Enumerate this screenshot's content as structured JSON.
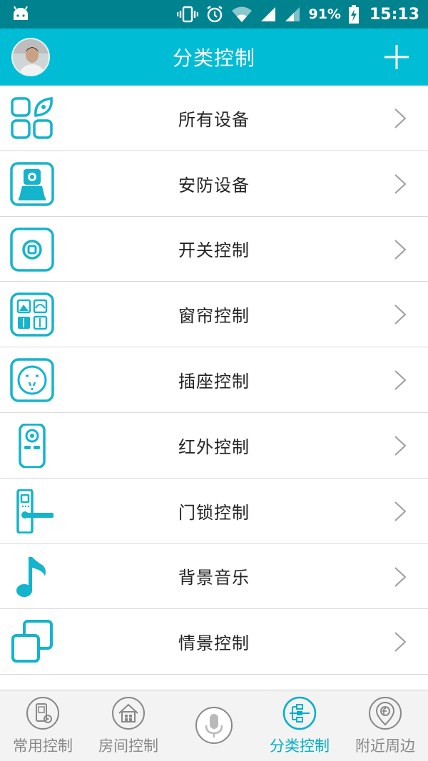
{
  "status_bar": {
    "battery_percent": "91%",
    "time": "15:13",
    "icons": [
      "android-icon",
      "vibrate-icon",
      "alarm-icon",
      "wifi-icon",
      "signal-icon",
      "signal-icon",
      "battery-charging-icon"
    ]
  },
  "header": {
    "title": "分类控制",
    "add_icon": "plus-icon",
    "avatar": "user-avatar"
  },
  "categories": [
    {
      "label": "所有设备",
      "icon": "all-devices-icon"
    },
    {
      "label": "安防设备",
      "icon": "security-camera-icon"
    },
    {
      "label": "开关控制",
      "icon": "switch-icon"
    },
    {
      "label": "窗帘控制",
      "icon": "curtain-icon"
    },
    {
      "label": "插座控制",
      "icon": "socket-icon"
    },
    {
      "label": "红外控制",
      "icon": "remote-control-icon"
    },
    {
      "label": "门锁控制",
      "icon": "door-lock-icon"
    },
    {
      "label": "背景音乐",
      "icon": "music-note-icon"
    },
    {
      "label": "情景控制",
      "icon": "scene-icon"
    }
  ],
  "bottom_nav": {
    "items": [
      {
        "label": "常用控制",
        "icon": "common-control-icon",
        "active": false
      },
      {
        "label": "房间控制",
        "icon": "room-control-icon",
        "active": false
      },
      {
        "label": "",
        "icon": "microphone-icon",
        "active": false
      },
      {
        "label": "分类控制",
        "icon": "category-control-icon",
        "active": true
      },
      {
        "label": "附近周边",
        "icon": "nearby-icon",
        "active": false
      }
    ]
  },
  "colors": {
    "status_bar": "#00838f",
    "header": "#00bcd4",
    "icon_accent": "#14b4cc",
    "active_nav": "#00b0c8",
    "inactive_nav": "#888888"
  }
}
